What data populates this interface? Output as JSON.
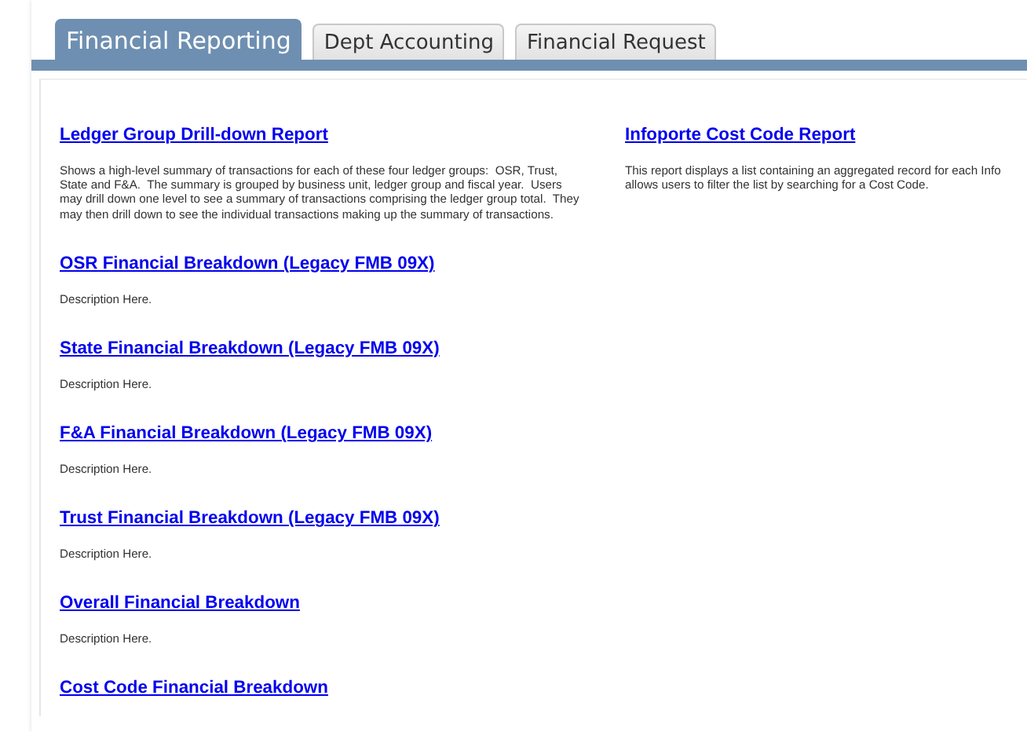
{
  "tabs": [
    {
      "label": "Financial Reporting",
      "selected": true
    },
    {
      "label": "Dept Accounting",
      "selected": false
    },
    {
      "label": "Financial Request",
      "selected": false
    }
  ],
  "columns": [
    {
      "reports": [
        {
          "title": "Ledger Group Drill-down Report",
          "description": "Shows a high-level summary of transactions for each of these four ledger groups:  OSR, Trust, State and F&A.  The summary is grouped by business unit, ledger group and fiscal year.  Users may drill down one level to see a summary of transactions comprising the ledger group total.  They may then drill down to see the individual transactions making up the summary of transactions."
        },
        {
          "title": "OSR Financial Breakdown (Legacy FMB 09X)",
          "description": "Description Here."
        },
        {
          "title": "State Financial Breakdown (Legacy FMB 09X)",
          "description": "Description Here."
        },
        {
          "title": "F&A Financial Breakdown (Legacy FMB 09X)",
          "description": "Description Here."
        },
        {
          "title": "Trust Financial Breakdown (Legacy FMB 09X)",
          "description": "Description Here."
        },
        {
          "title": "Overall Financial Breakdown",
          "description": "Description Here."
        },
        {
          "title": "Cost Code Financial Breakdown"
        }
      ]
    },
    {
      "reports": [
        {
          "title": "Infoporte Cost Code Report",
          "description_lines": [
            "This report displays a list containing an aggregated record for each Info",
            "allows users to filter the list by searching for a Cost Code."
          ]
        }
      ]
    }
  ]
}
